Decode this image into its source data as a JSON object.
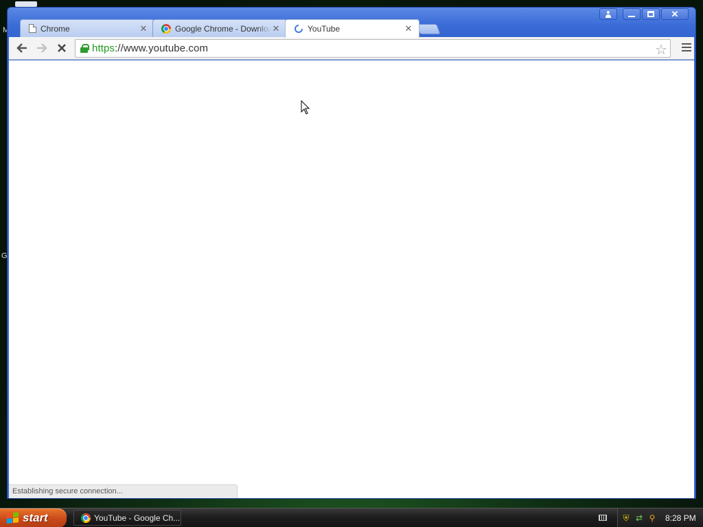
{
  "window": {
    "tabs": [
      {
        "title": "Chrome",
        "close": "✕"
      },
      {
        "title": "Google Chrome - Download the Fast, Secure Browser from Google",
        "close": "✕"
      },
      {
        "title": "YouTube",
        "close": "✕"
      }
    ],
    "caption": {
      "close": "✕"
    }
  },
  "toolbar": {
    "back_glyph": "🡐",
    "forward_glyph": "🡒",
    "stop_glyph": "✕",
    "url_scheme": "https",
    "url_rest": "://www.youtube.com",
    "star_glyph": "☆"
  },
  "status": {
    "text": "Establishing secure connection..."
  },
  "desktop": {
    "glyph_top": "M",
    "glyph_mid": "G"
  },
  "taskbar": {
    "start_label": "start",
    "task_item": "YouTube - Google Ch...",
    "clock": "8:28 PM"
  },
  "colors": {
    "titlebar": "#3a6bd6",
    "secure_green": "#1e9b1e",
    "start_orange": "#c9491a"
  }
}
